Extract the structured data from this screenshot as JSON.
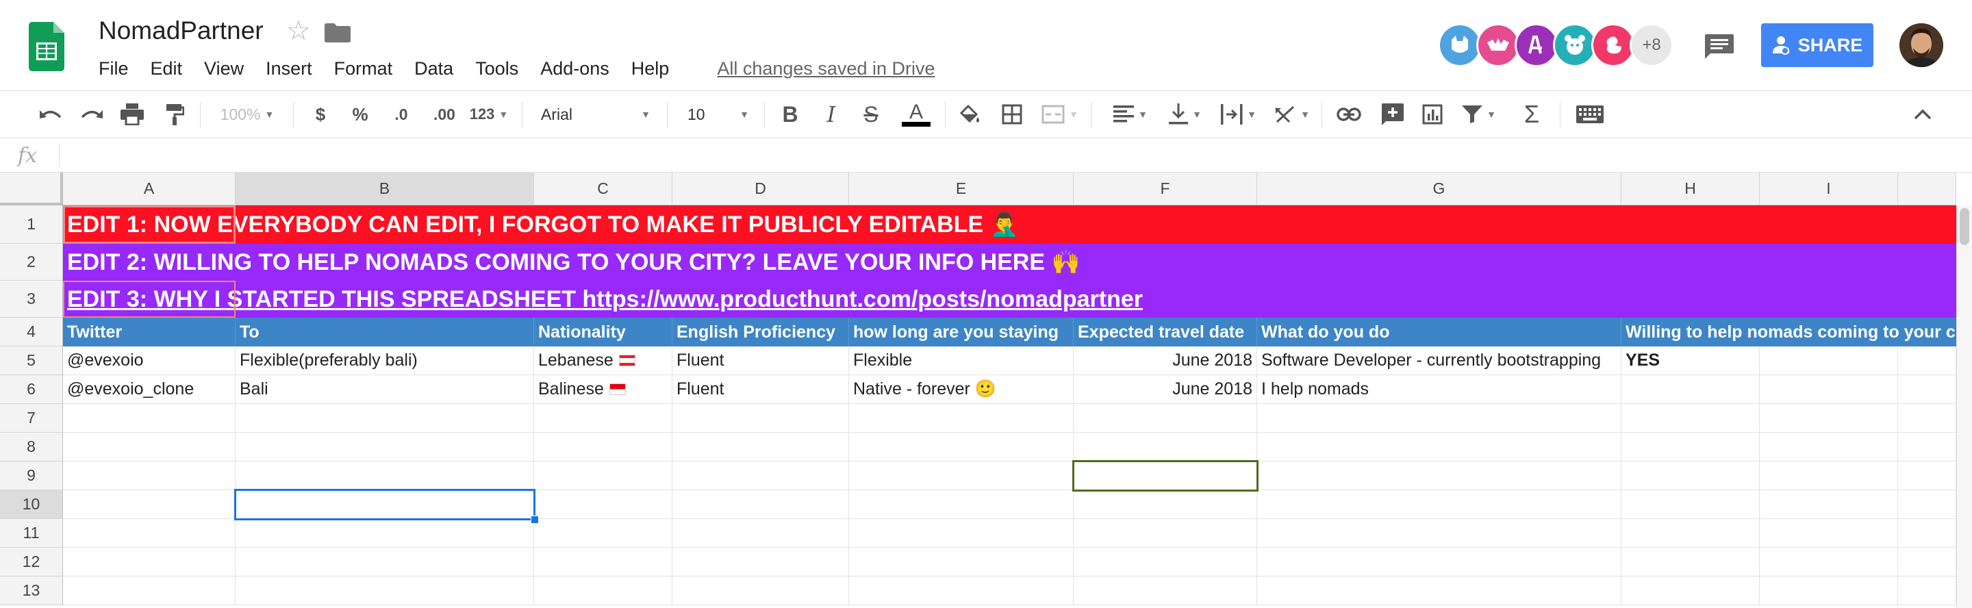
{
  "app": {
    "doc_title": "NomadPartner",
    "menu": [
      "File",
      "Edit",
      "View",
      "Insert",
      "Format",
      "Data",
      "Tools",
      "Add-ons",
      "Help"
    ],
    "save_status": "All changes saved in Drive",
    "collaborators_more": "+8",
    "share_label": "SHARE"
  },
  "toolbar": {
    "zoom": "100%",
    "currency": "$",
    "percent": "%",
    "decrease_decimals": ".0",
    "increase_decimals": ".00",
    "more_formats": "123",
    "font": "Arial",
    "font_size": "10"
  },
  "formula_bar": {
    "fx": "fx",
    "value": ""
  },
  "columns": [
    "A",
    "B",
    "C",
    "D",
    "E",
    "F",
    "G",
    "H",
    "I"
  ],
  "rows": [
    "1",
    "2",
    "3",
    "4",
    "5",
    "6",
    "7",
    "8",
    "9",
    "10",
    "11",
    "12",
    "13"
  ],
  "banners": [
    "EDIT 1: NOW EVERYBODY CAN EDIT, I FORGOT TO MAKE IT PUBLICLY EDITABLE 🤦‍♂️",
    "EDIT 2: WILLING TO HELP NOMADS COMING TO YOUR CITY? LEAVE YOUR INFO HERE 🙌",
    "EDIT 3: WHY I STARTED THIS SPREADSHEET https://www.producthunt.com/posts/nomadpartner"
  ],
  "headers": [
    "Twitter",
    "To",
    "Nationality",
    "English Proficiency",
    "how long are you staying",
    "Expected travel date",
    "What do you do",
    "Willing to help nomads coming to your city?",
    ""
  ],
  "data_rows": [
    [
      "@evexoio",
      "Flexible(preferably bali)",
      "Lebanese",
      "Fluent",
      "Flexible",
      "June 2018",
      "Software Developer - currently bootstrapping",
      "YES",
      ""
    ],
    [
      "@evexoio_clone",
      "Bali",
      "Balinese",
      "Fluent",
      "Native - forever 🙂",
      "June 2018",
      "I help nomads",
      "",
      ""
    ]
  ],
  "colors": {
    "banner1": "#fc1022",
    "banner2": "#9829fb",
    "header": "#3d85c6",
    "share": "#4285f4",
    "selection": "#1a73e8",
    "collaborator_selection": "#4e6b1f"
  },
  "icons": [
    "sheets-logo",
    "star-icon",
    "folder-icon",
    "comments-icon",
    "undo-icon",
    "redo-icon",
    "print-icon",
    "paint-format-icon",
    "bold-icon",
    "italic-icon",
    "strikethrough-icon",
    "text-color-icon",
    "fill-color-icon",
    "borders-icon",
    "merge-icon",
    "align-left-icon",
    "valign-icon",
    "wrap-icon",
    "rotate-icon",
    "link-icon",
    "comment-add-icon",
    "chart-icon",
    "filter-icon",
    "functions-icon",
    "keyboard-icon",
    "collapse-icon"
  ]
}
